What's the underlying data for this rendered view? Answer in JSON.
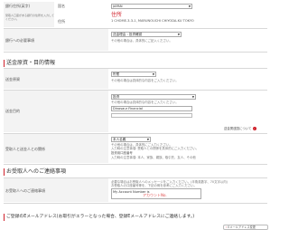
{
  "bank_address": {
    "label": "銀行住所(英字)",
    "label_sub_line1": "受取人口座がある銀行の住所を入力してください。",
    "label_sub_line2": "",
    "country_label": "国名",
    "country_value": "JAPAN",
    "address_label": "住所",
    "address_heading": "住所",
    "address_value": "1 CHOME-3-3-1, MARUNOUCHI CHIYODA-KU TOKYO"
  },
  "other_info": {
    "label": "銀行への必要事項",
    "select_value": "送金理由 : 投資確認",
    "note": "その他の場合は、具体的にご記入ください。"
  },
  "purpose_section": {
    "title": "送金原資・目的情報",
    "source_label": "送金原資",
    "source_value": "貯蓄",
    "source_note": "その他の場合は具体的な内容をご入力ください。",
    "purpose_label": "送金目的",
    "purpose_value": "投資",
    "purpose_note": "その他の場合は具体的な内容をご入力ください。",
    "purpose_input": "Dinosaur Financial",
    "goods_link": "送金関連国について"
  },
  "relation": {
    "label": "受取人と送金人との関係",
    "select_value": "本人名義",
    "note_line1": "その他の場合は、具体的にご入力ください。",
    "note_line2": "入力時の注意事項: 受取人との関係を具体的にご入力ください。",
    "note_line3": "例 : 本人名義、親族等",
    "note_line4": "入力時の注意事項: 本人、家族、親族、取引先、友人、その他",
    "box_label": "投資用口座番号",
    "box_value": ""
  },
  "message_section": {
    "title": "お受取人へのご連絡事項",
    "label": "お受取人へのご連絡事項",
    "note_line1": "必要な場合はお受取人へのメッセージをご入力ください。(半角英数字、70文字以内)",
    "note_line2": "お受取人の口座番号等を、下記の例を参考にご入力ください。",
    "input_value": "My Account Number is",
    "input_overlay": "アカウントNo."
  },
  "email_section": {
    "title": "ご登録のEメールアドレス(お取引がエラーとなった場合、登録Eメールアドレスにご連絡します。)",
    "change_link": "Eメールアドレス変更"
  },
  "colors": {
    "accent": "#d0202a",
    "link": "#1a4fa0"
  }
}
